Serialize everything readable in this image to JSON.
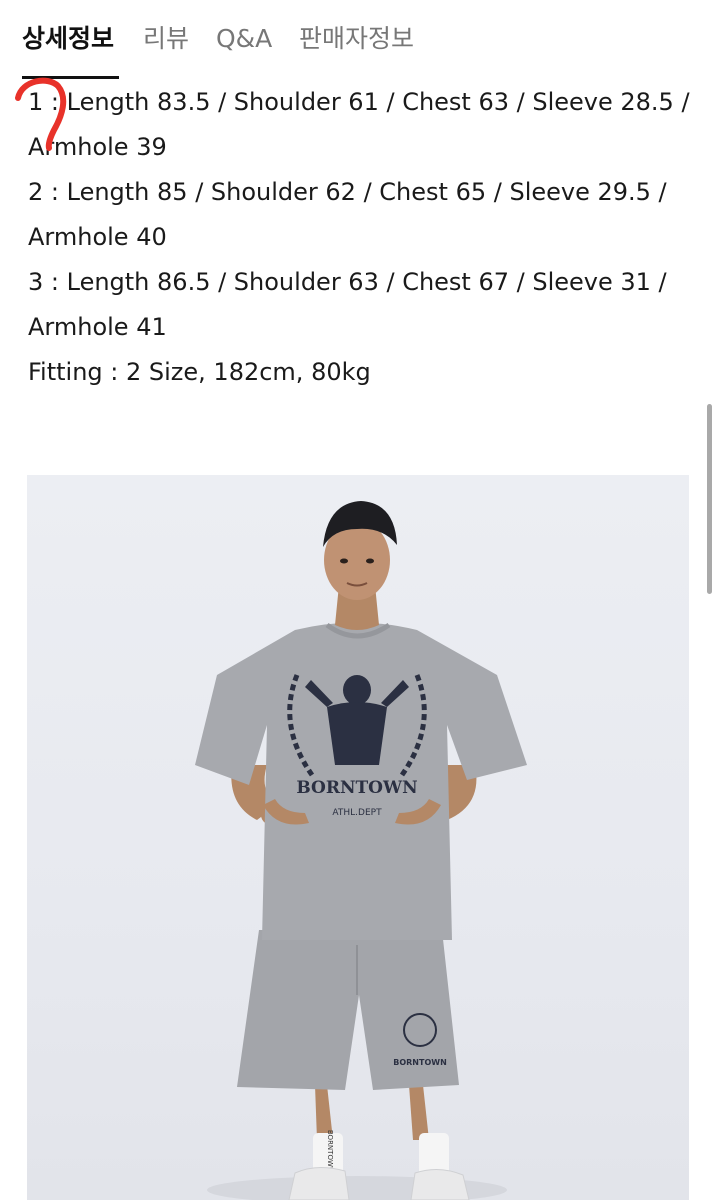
{
  "tabs": [
    {
      "label": "상세정보",
      "active": true
    },
    {
      "label": "리뷰",
      "active": false
    },
    {
      "label": "Q&A",
      "active": false
    },
    {
      "label": "판매자정보",
      "active": false
    }
  ],
  "specs": {
    "lines": [
      "1 : Length 83.5 / Shoulder 61 / Chest 63 / Sleeve 28.5 /",
      "Armhole 39",
      "2 : Length 85 / Shoulder 62 / Chest 65 / Sleeve 29.5 /",
      "Armhole 40",
      "3 : Length 86.5 / Shoulder 63 / Chest 67 / Sleeve 31 /",
      "Armhole 41",
      "Fitting : 2 Size, 182cm, 80kg"
    ]
  },
  "photo": {
    "shirt_print": "BORNTOWN",
    "shirt_print_sub": "ATHL.DEPT",
    "shorts_print": "BORNTOWN",
    "sock_print": "BORNTOWN"
  },
  "colors": {
    "annotation": "#e8322a",
    "active_tab": "#111111",
    "inactive_tab": "#777777",
    "garment": "#a7a9ae"
  }
}
